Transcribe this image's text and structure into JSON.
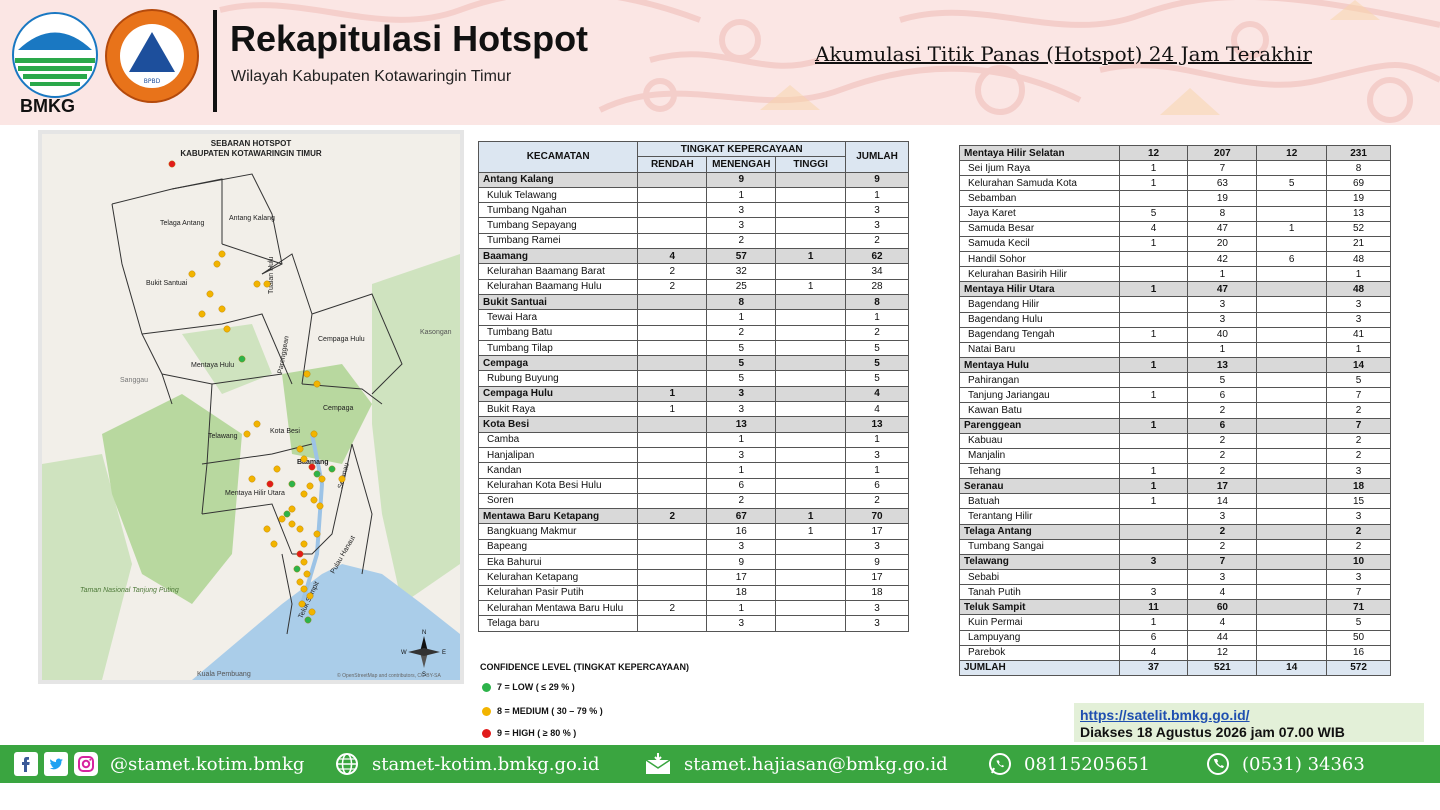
{
  "header": {
    "bmkg_label": "BMKG",
    "title": "Rekapitulasi Hotspot",
    "subtitle": "Wilayah Kabupaten Kotawaringin Timur",
    "right_title": "Akumulasi Titik Panas (Hotspot) 24 Jam Terakhir",
    "bpbd_label": "BPBD"
  },
  "map": {
    "title1": "SEBARAN HOTSPOT",
    "title2": "KABUPATEN KOTAWARINGIN TIMUR",
    "regions": [
      "Telaga Antang",
      "Antang Kalang",
      "Tualan Hulu",
      "Bukit Santuai",
      "Cempaga Hulu",
      "Mentaya Hulu",
      "Parenggean",
      "Cempaga",
      "Telawang",
      "Kota Besi",
      "Baamang",
      "Seranau",
      "Mentaya Hilir Utara",
      "Pulau Hanaut",
      "Teluk Sampit"
    ],
    "places": [
      "Kasongan",
      "Sanggau",
      "Taman Nasional Tanjung Puting",
      "Kuala Pembuang"
    ],
    "attribution": "© OpenStreetMap and contributors, CC-BY-SA",
    "compass": [
      "N",
      "W",
      "E",
      "S"
    ]
  },
  "table_left": {
    "header_kecamatan": "KECAMATAN",
    "header_tingkat": "TINGKAT KEPERCAYAAN",
    "header_rendah": "RENDAH",
    "header_menengah": "MENENGAH",
    "header_tinggi": "TINGGI",
    "header_jumlah": "JUMLAH",
    "rows": [
      {
        "t": "k",
        "n": "Antang Kalang",
        "r": "",
        "m": "9",
        "h": "",
        "j": "9"
      },
      {
        "t": "d",
        "n": "Kuluk Telawang",
        "r": "",
        "m": "1",
        "h": "",
        "j": "1"
      },
      {
        "t": "d",
        "n": "Tumbang Ngahan",
        "r": "",
        "m": "3",
        "h": "",
        "j": "3"
      },
      {
        "t": "d",
        "n": "Tumbang Sepayang",
        "r": "",
        "m": "3",
        "h": "",
        "j": "3"
      },
      {
        "t": "d",
        "n": "Tumbang Ramei",
        "r": "",
        "m": "2",
        "h": "",
        "j": "2"
      },
      {
        "t": "k",
        "n": "Baamang",
        "r": "4",
        "m": "57",
        "h": "1",
        "j": "62"
      },
      {
        "t": "d",
        "n": "Kelurahan Baamang Barat",
        "r": "2",
        "m": "32",
        "h": "",
        "j": "34"
      },
      {
        "t": "d",
        "n": "Kelurahan Baamang Hulu",
        "r": "2",
        "m": "25",
        "h": "1",
        "j": "28"
      },
      {
        "t": "k",
        "n": "Bukit Santuai",
        "r": "",
        "m": "8",
        "h": "",
        "j": "8"
      },
      {
        "t": "d",
        "n": "Tewai Hara",
        "r": "",
        "m": "1",
        "h": "",
        "j": "1"
      },
      {
        "t": "d",
        "n": "Tumbang Batu",
        "r": "",
        "m": "2",
        "h": "",
        "j": "2"
      },
      {
        "t": "d",
        "n": "Tumbang Tilap",
        "r": "",
        "m": "5",
        "h": "",
        "j": "5"
      },
      {
        "t": "k",
        "n": "Cempaga",
        "r": "",
        "m": "5",
        "h": "",
        "j": "5"
      },
      {
        "t": "d",
        "n": "Rubung Buyung",
        "r": "",
        "m": "5",
        "h": "",
        "j": "5"
      },
      {
        "t": "k",
        "n": "Cempaga Hulu",
        "r": "1",
        "m": "3",
        "h": "",
        "j": "4"
      },
      {
        "t": "d",
        "n": "Bukit Raya",
        "r": "1",
        "m": "3",
        "h": "",
        "j": "4"
      },
      {
        "t": "k",
        "n": "Kota Besi",
        "r": "",
        "m": "13",
        "h": "",
        "j": "13"
      },
      {
        "t": "d",
        "n": "Camba",
        "r": "",
        "m": "1",
        "h": "",
        "j": "1"
      },
      {
        "t": "d",
        "n": "Hanjalipan",
        "r": "",
        "m": "3",
        "h": "",
        "j": "3"
      },
      {
        "t": "d",
        "n": "Kandan",
        "r": "",
        "m": "1",
        "h": "",
        "j": "1"
      },
      {
        "t": "d",
        "n": "Kelurahan Kota Besi Hulu",
        "r": "",
        "m": "6",
        "h": "",
        "j": "6"
      },
      {
        "t": "d",
        "n": "Soren",
        "r": "",
        "m": "2",
        "h": "",
        "j": "2"
      },
      {
        "t": "k",
        "n": "Mentawa Baru Ketapang",
        "r": "2",
        "m": "67",
        "h": "1",
        "j": "70"
      },
      {
        "t": "d",
        "n": "Bangkuang Makmur",
        "r": "",
        "m": "16",
        "h": "1",
        "j": "17"
      },
      {
        "t": "d",
        "n": "Bapeang",
        "r": "",
        "m": "3",
        "h": "",
        "j": "3"
      },
      {
        "t": "d",
        "n": "Eka Bahurui",
        "r": "",
        "m": "9",
        "h": "",
        "j": "9"
      },
      {
        "t": "d",
        "n": "Kelurahan Ketapang",
        "r": "",
        "m": "17",
        "h": "",
        "j": "17"
      },
      {
        "t": "d",
        "n": "Kelurahan Pasir Putih",
        "r": "",
        "m": "18",
        "h": "",
        "j": "18"
      },
      {
        "t": "d",
        "n": "Kelurahan Mentawa Baru Hulu",
        "r": "2",
        "m": "1",
        "h": "",
        "j": "3"
      },
      {
        "t": "d",
        "n": "Telaga baru",
        "r": "",
        "m": "3",
        "h": "",
        "j": "3"
      }
    ]
  },
  "table_right": {
    "rows": [
      {
        "t": "k",
        "n": "Mentaya Hilir Selatan",
        "r": "12",
        "m": "207",
        "h": "12",
        "j": "231"
      },
      {
        "t": "d",
        "n": "Sei Ijum Raya",
        "r": "1",
        "m": "7",
        "h": "",
        "j": "8"
      },
      {
        "t": "d",
        "n": "Kelurahan Samuda Kota",
        "r": "1",
        "m": "63",
        "h": "5",
        "j": "69"
      },
      {
        "t": "d",
        "n": "Sebamban",
        "r": "",
        "m": "19",
        "h": "",
        "j": "19"
      },
      {
        "t": "d",
        "n": "Jaya Karet",
        "r": "5",
        "m": "8",
        "h": "",
        "j": "13"
      },
      {
        "t": "d",
        "n": "Samuda Besar",
        "r": "4",
        "m": "47",
        "h": "1",
        "j": "52"
      },
      {
        "t": "d",
        "n": "Samuda Kecil",
        "r": "1",
        "m": "20",
        "h": "",
        "j": "21"
      },
      {
        "t": "d",
        "n": "Handil Sohor",
        "r": "",
        "m": "42",
        "h": "6",
        "j": "48"
      },
      {
        "t": "d",
        "n": "Kelurahan Basirih Hilir",
        "r": "",
        "m": "1",
        "h": "",
        "j": "1"
      },
      {
        "t": "k",
        "n": "Mentaya Hilir Utara",
        "r": "1",
        "m": "47",
        "h": "",
        "j": "48"
      },
      {
        "t": "d",
        "n": "Bagendang Hilir",
        "r": "",
        "m": "3",
        "h": "",
        "j": "3"
      },
      {
        "t": "d",
        "n": "Bagendang Hulu",
        "r": "",
        "m": "3",
        "h": "",
        "j": "3"
      },
      {
        "t": "d",
        "n": "Bagendang Tengah",
        "r": "1",
        "m": "40",
        "h": "",
        "j": "41"
      },
      {
        "t": "d",
        "n": "Natai Baru",
        "r": "",
        "m": "1",
        "h": "",
        "j": "1"
      },
      {
        "t": "k",
        "n": "Mentaya Hulu",
        "r": "1",
        "m": "13",
        "h": "",
        "j": "14"
      },
      {
        "t": "d",
        "n": "Pahirangan",
        "r": "",
        "m": "5",
        "h": "",
        "j": "5"
      },
      {
        "t": "d",
        "n": "Tanjung Jariangau",
        "r": "1",
        "m": "6",
        "h": "",
        "j": "7"
      },
      {
        "t": "d",
        "n": "Kawan Batu",
        "r": "",
        "m": "2",
        "h": "",
        "j": "2"
      },
      {
        "t": "k",
        "n": "Parenggean",
        "r": "1",
        "m": "6",
        "h": "",
        "j": "7"
      },
      {
        "t": "d",
        "n": "Kabuau",
        "r": "",
        "m": "2",
        "h": "",
        "j": "2"
      },
      {
        "t": "d",
        "n": "Manjalin",
        "r": "",
        "m": "2",
        "h": "",
        "j": "2"
      },
      {
        "t": "d",
        "n": "Tehang",
        "r": "1",
        "m": "2",
        "h": "",
        "j": "3"
      },
      {
        "t": "k",
        "n": "Seranau",
        "r": "1",
        "m": "17",
        "h": "",
        "j": "18"
      },
      {
        "t": "d",
        "n": "Batuah",
        "r": "1",
        "m": "14",
        "h": "",
        "j": "15"
      },
      {
        "t": "d",
        "n": "Terantang Hilir",
        "r": "",
        "m": "3",
        "h": "",
        "j": "3"
      },
      {
        "t": "k",
        "n": "Telaga Antang",
        "r": "",
        "m": "2",
        "h": "",
        "j": "2"
      },
      {
        "t": "d",
        "n": "Tumbang Sangai",
        "r": "",
        "m": "2",
        "h": "",
        "j": "2"
      },
      {
        "t": "k",
        "n": "Telawang",
        "r": "3",
        "m": "7",
        "h": "",
        "j": "10"
      },
      {
        "t": "d",
        "n": "Sebabi",
        "r": "",
        "m": "3",
        "h": "",
        "j": "3"
      },
      {
        "t": "d",
        "n": "Tanah Putih",
        "r": "3",
        "m": "4",
        "h": "",
        "j": "7"
      },
      {
        "t": "k",
        "n": "Teluk Sampit",
        "r": "11",
        "m": "60",
        "h": "",
        "j": "71"
      },
      {
        "t": "d",
        "n": "Kuin Permai",
        "r": "1",
        "m": "4",
        "h": "",
        "j": "5"
      },
      {
        "t": "d",
        "n": "Lampuyang",
        "r": "6",
        "m": "44",
        "h": "",
        "j": "50"
      },
      {
        "t": "d",
        "n": "Parebok",
        "r": "4",
        "m": "12",
        "h": "",
        "j": "16"
      },
      {
        "t": "s",
        "n": "JUMLAH",
        "r": "37",
        "m": "521",
        "h": "14",
        "j": "572"
      }
    ]
  },
  "legend": {
    "title": "CONFIDENCE LEVEL (TINGKAT KEPERCAYAAN)",
    "items": [
      {
        "label": "7 = LOW ( ≤ 29 % )",
        "color": "#2db34a"
      },
      {
        "label": "8 = MEDIUM ( 30 – 79 % )",
        "color": "#f2b400"
      },
      {
        "label": "9 = HIGH ( ≥ 80 % )",
        "color": "#e11b1b"
      }
    ]
  },
  "info": {
    "url": "https://satelit.bmkg.go.id/",
    "accessed": "Diakses 18 Agustus 2026 jam 07.00 WIB"
  },
  "footer": {
    "instagram": "@stamet.kotim.bmkg",
    "website": "stamet-kotim.bmkg.go.id",
    "email": "stamet.hajiasan@bmkg.go.id",
    "whatsapp": "08115205651",
    "phone": "(0531) 34363"
  },
  "colors": {
    "footer_green": "#3aa540",
    "header_pink": "#fbe6e4",
    "table_header_blue": "#dce6f1",
    "kecamatan_gray": "#d9d9d9"
  }
}
